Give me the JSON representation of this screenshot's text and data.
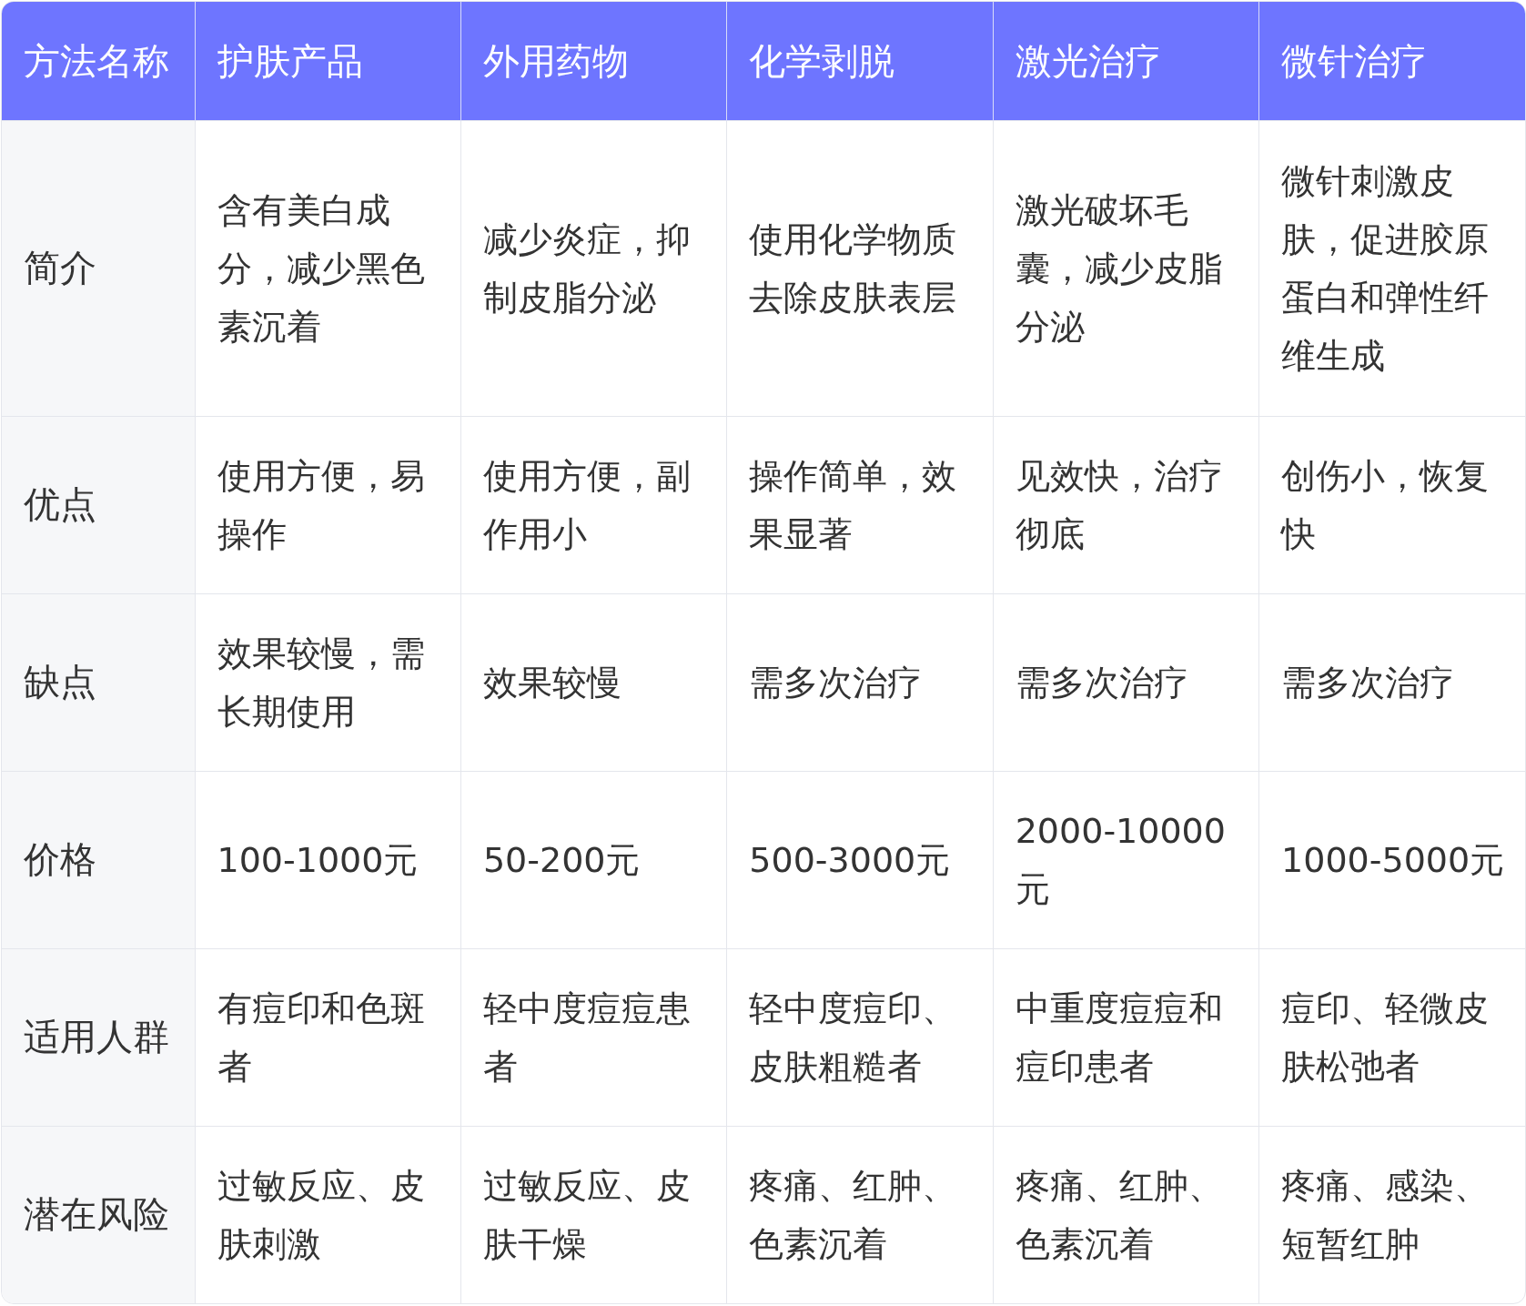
{
  "table": {
    "columns": [
      "方法名称",
      "护肤产品",
      "外用药物",
      "化学剥脱",
      "激光治疗",
      "微针治疗"
    ],
    "rows": [
      {
        "cells": [
          "简介",
          "含有美白成分，减少黑色素沉着",
          "减少炎症，抑制皮脂分泌",
          "使用化学物质去除皮肤表层",
          "激光破坏毛囊，减少皮脂分泌",
          "微针刺激皮肤，促进胶原蛋白和弹性纤维生成"
        ]
      },
      {
        "cells": [
          "优点",
          "使用方便，易操作",
          "使用方便，副作用小",
          "操作简单，效果显著",
          "见效快，治疗彻底",
          "创伤小，恢复快"
        ]
      },
      {
        "cells": [
          "缺点",
          "效果较慢，需长期使用",
          "效果较慢",
          "需多次治疗",
          "需多次治疗",
          "需多次治疗"
        ]
      },
      {
        "cells": [
          "价格",
          "100-1000元",
          "50-200元",
          "500-3000元",
          "2000-10000元",
          "1000-5000元"
        ]
      },
      {
        "cells": [
          "适用人群",
          "有痘印和色斑者",
          "轻中度痘痘患者",
          "轻中度痘印、皮肤粗糙者",
          "中重度痘痘和痘印患者",
          "痘印、轻微皮肤松弛者"
        ]
      },
      {
        "cells": [
          "潜在风险",
          "过敏反应、皮肤刺激",
          "过敏反应、皮肤干燥",
          "疼痛、红肿、色素沉着",
          "疼痛、红肿、色素沉着",
          "疼痛、感染、短暂红肿"
        ]
      }
    ]
  }
}
